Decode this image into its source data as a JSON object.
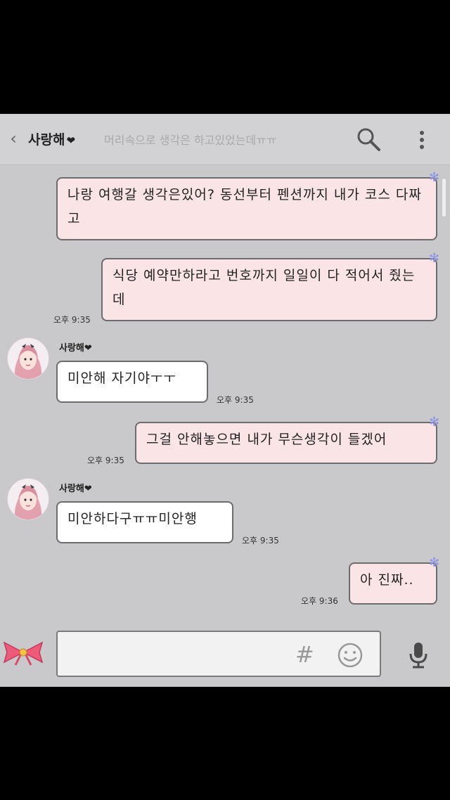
{
  "header": {
    "back_icon": "chevron-left-icon",
    "title": "사랑해",
    "title_heart": "❤",
    "search_preview": "머리속으로 생각은 하고있었는데ㅠㅠ",
    "search_icon": "search-icon",
    "more_icon": "more-vertical-icon"
  },
  "messages": [
    {
      "from": "me",
      "text": "나랑 여행갈 생각은있어? 동선부터 펜션까지 내가 코스 다짜고",
      "time": ""
    },
    {
      "from": "me",
      "text": "식당 예약만하라고 번호까지 일일이 다 적어서 줬는데",
      "time": "오후 9:35"
    },
    {
      "from": "them",
      "sender": "사랑해",
      "sender_heart": "❤",
      "text": "미안해 자기야ㅜㅜ",
      "time": "오후 9:35"
    },
    {
      "from": "me",
      "text": "그걸 안해놓으면 내가 무슨생각이 들겠어",
      "time": "오후 9:35"
    },
    {
      "from": "them",
      "sender": "사랑해",
      "sender_heart": "❤",
      "text": "미안하다구ㅠㅠ미안행",
      "time": "오후 9:35"
    },
    {
      "from": "me",
      "text": "아 진짜..",
      "time": "오후 9:36"
    }
  ],
  "composer": {
    "hash_label": "#",
    "emoji_icon": "smiley-icon",
    "mic_icon": "microphone-icon",
    "bow_icon": "pink-bow-icon"
  },
  "colors": {
    "my_bubble": "#fbe4e6",
    "their_bubble": "#ffffff",
    "background": "#c9c9cb",
    "star_accent": "#8e96e8"
  }
}
